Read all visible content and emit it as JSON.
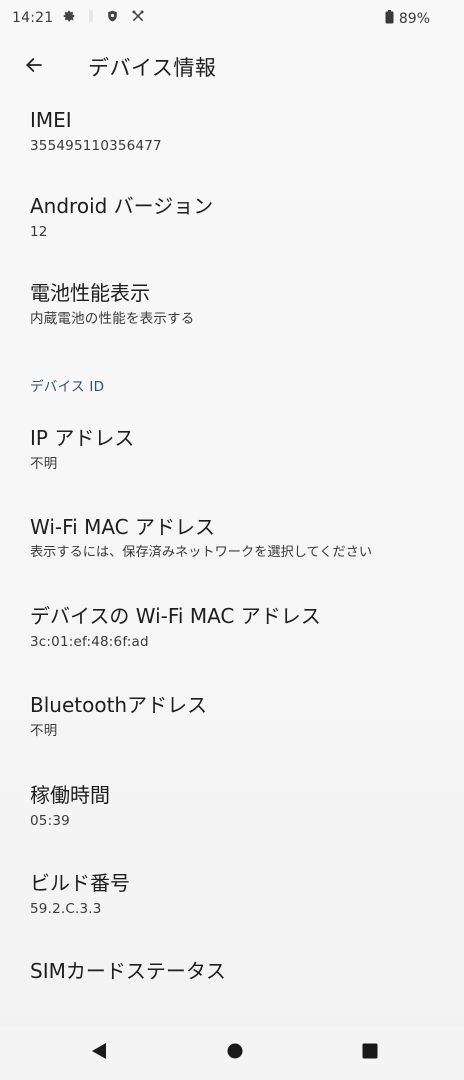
{
  "status_bar": {
    "time": "14:21",
    "battery_percent": "89%",
    "icons": [
      "gear-icon",
      "notification-dot-icon",
      "shield-icon",
      "tools-icon",
      "battery-icon"
    ]
  },
  "app_bar": {
    "title": "デバイス情報",
    "back_icon": "arrow-back-icon"
  },
  "items": [
    {
      "title": "IMEI",
      "summary": "355495110356477"
    },
    {
      "title": "Android バージョン",
      "summary": "12"
    },
    {
      "title": "電池性能表示",
      "summary": "内蔵電池の性能を表示する"
    }
  ],
  "section": {
    "header": "デバイス ID",
    "items": [
      {
        "title": "IP アドレス",
        "summary": "不明"
      },
      {
        "title": "Wi-Fi MAC アドレス",
        "summary": "表示するには、保存済みネットワークを選択してください"
      },
      {
        "title": "デバイスの Wi-Fi MAC アドレス",
        "summary": "3c:01:ef:48:6f:ad"
      },
      {
        "title": "Bluetoothアドレス",
        "summary": "不明"
      },
      {
        "title": "稼働時間",
        "summary": "05:39"
      },
      {
        "title": "ビルド番号",
        "summary": "59.2.C.3.3"
      },
      {
        "title": "SIMカードステータス"
      }
    ]
  },
  "nav_bar": {
    "icons": [
      "nav-back-icon",
      "nav-home-icon",
      "nav-recents-icon"
    ]
  },
  "colors": {
    "background": "#f7f7f7",
    "text_primary": "#1e1e1e",
    "text_secondary": "#3a3a3a",
    "section_header": "#2e5573"
  }
}
